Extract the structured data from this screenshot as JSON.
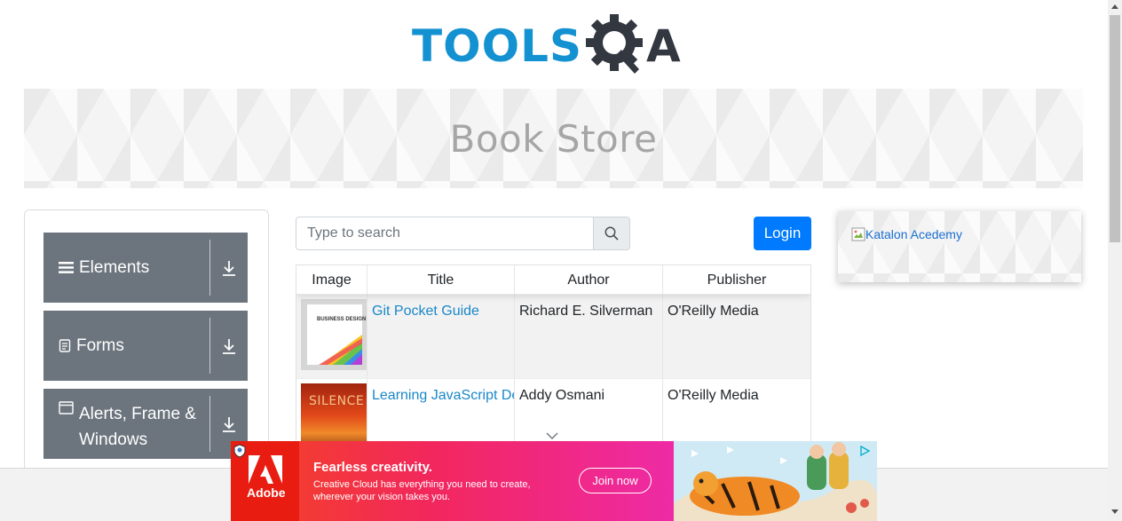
{
  "logo": {
    "part1": "TOOLS",
    "part2": "A"
  },
  "banner": {
    "title": "Book Store"
  },
  "left_nav": {
    "groups": [
      {
        "label": "Elements",
        "icon": "hamburger-icon"
      },
      {
        "label": "Forms",
        "icon": "document-icon"
      },
      {
        "label": "Alerts, Frame & Windows",
        "icon": "window-icon"
      }
    ]
  },
  "search": {
    "placeholder": "Type to search",
    "value": ""
  },
  "login": {
    "label": "Login"
  },
  "table": {
    "headers": [
      "Image",
      "Title",
      "Author",
      "Publisher"
    ],
    "rows": [
      {
        "title": "Git Pocket Guide",
        "author": "Richard E. Silverman",
        "publisher": "O'Reilly Media",
        "cover_text": "BUSINESS DESIGN"
      },
      {
        "title": "Learning JavaScript De",
        "author": "Addy Osmani",
        "publisher": "O'Reilly Media",
        "cover_text": "SILENCE"
      }
    ]
  },
  "side_ad": {
    "alt_text": "Katalon Acedemy"
  },
  "bottom_ad": {
    "brand": "Adobe",
    "headline": "Fearless creativity.",
    "subtext": "Creative Cloud has everything you need to create, wherever your vision takes you.",
    "cta": "Join now"
  },
  "colors": {
    "primary": "#007bff",
    "nav_gray": "#6c757d",
    "logo_blue": "#1391d1",
    "link": "#1a88c9"
  }
}
